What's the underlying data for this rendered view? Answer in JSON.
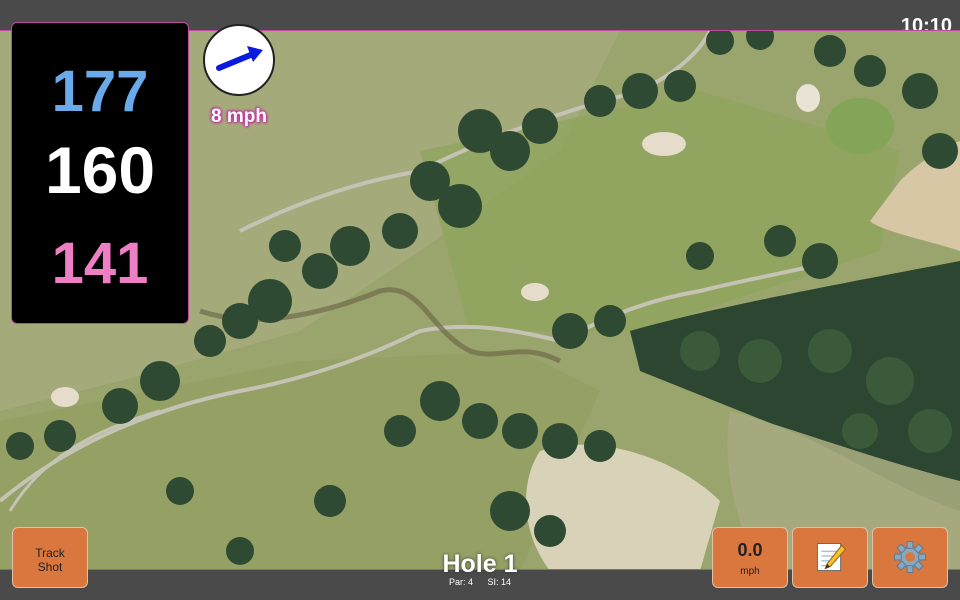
{
  "status": {
    "time": "10:10"
  },
  "yardages": {
    "back": "177",
    "middle": "160",
    "front": "141"
  },
  "wind": {
    "speed_label": "8 mph",
    "direction": "east-northeast"
  },
  "buttons": {
    "track_shot": [
      "Track",
      "Shot"
    ],
    "wind_value": "0.0",
    "wind_unit": "mph",
    "notes_icon": "notepad-icon",
    "settings_icon": "gear-icon"
  },
  "hole": {
    "title": "Hole 1",
    "par": "Par: 4",
    "si": "SI: 14"
  },
  "colors": {
    "back_yardage": "#6aa9ea",
    "middle_yardage": "#ffffff",
    "front_yardage": "#ee7fc4",
    "button": "#d9773e",
    "accent_border": "#c04aa0"
  }
}
